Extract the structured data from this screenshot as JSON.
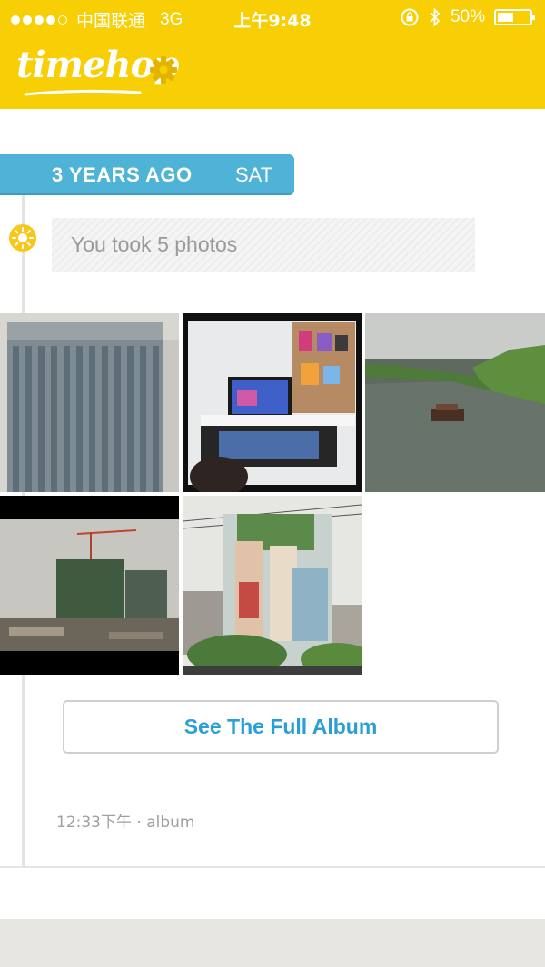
{
  "status_bar": {
    "carrier": "中国联通",
    "network": "3G",
    "time": "上午9:48",
    "battery_text": "50%",
    "battery_level": 0.5,
    "signal_bars_filled": 4,
    "signal_bars_total": 5
  },
  "header": {
    "logo_text": "timehop",
    "settings_icon": "gear-icon",
    "background_color": "#f8cf04"
  },
  "moment": {
    "years_ago": "3 YEARS AGO",
    "day": "SAT",
    "icon": "sun-icon",
    "title": "You took 5 photos",
    "accent_color": "#4eb3d6",
    "photos": [
      {
        "subject": "office tower"
      },
      {
        "subject": "tv room"
      },
      {
        "subject": "river with boat"
      },
      {
        "subject": "construction site"
      },
      {
        "subject": "mural building"
      }
    ],
    "album_button_label": "See The Full Album",
    "meta": "12:33下午 · album"
  }
}
